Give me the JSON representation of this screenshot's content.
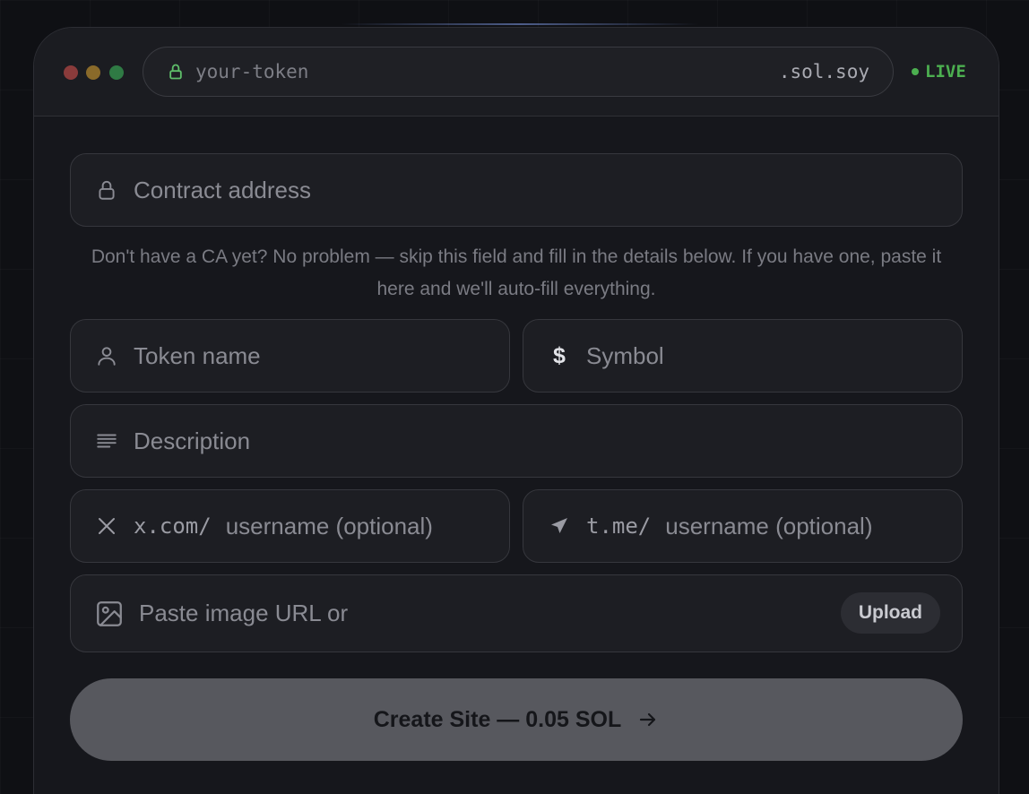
{
  "browser": {
    "subdomain": "your-token",
    "domain_suffix": ".sol.soy",
    "status": "LIVE"
  },
  "form": {
    "contract_placeholder": "Contract address",
    "helper_text": "Don't have a CA yet? No problem — skip this field and fill in the details below. If you have one, paste it here and we'll auto-fill everything.",
    "token_name_placeholder": "Token name",
    "symbol_placeholder": "Symbol",
    "symbol_glyph": "$",
    "description_placeholder": "Description",
    "x_prefix": "x.com/",
    "x_placeholder": "username (optional)",
    "telegram_prefix": "t.me/",
    "telegram_placeholder": "username (optional)",
    "image_placeholder": "Paste image URL or",
    "upload_label": "Upload",
    "submit_label": "Create Site — 0.05 SOL"
  },
  "icons": [
    "lock-icon",
    "user-icon",
    "dollar-icon",
    "description-icon",
    "x-logo-icon",
    "send-icon",
    "image-icon",
    "arrow-right-icon"
  ],
  "colors": {
    "live": "#4caf50",
    "button": "#57585e",
    "background": "#16171c"
  }
}
